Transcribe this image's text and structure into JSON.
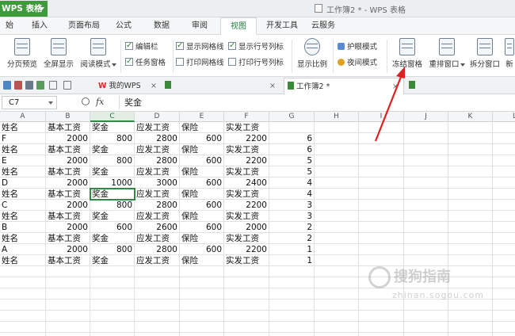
{
  "app": {
    "name": "WPS 表格",
    "window_title": "工作簿2 * - WPS 表格"
  },
  "menu": {
    "tabs": [
      {
        "label": "始"
      },
      {
        "label": "插入"
      },
      {
        "label": "页面布局"
      },
      {
        "label": "公式"
      },
      {
        "label": "数据"
      },
      {
        "label": "审阅"
      },
      {
        "label": "视图"
      },
      {
        "label": "开发工具"
      },
      {
        "label": "云服务"
      }
    ],
    "active": "视图"
  },
  "ribbon": {
    "page_preview": "分页预览",
    "full_screen": "全屏显示",
    "reading_mode": "阅读模式",
    "edit_bar": "编辑栏",
    "task_pane": "任务窗格",
    "show_gridlines": "显示网格线",
    "print_gridlines": "打印网格线",
    "show_row_col_headers": "显示行号列标",
    "print_row_col_headers": "打印行号列标",
    "zoom_ratio": "显示比例",
    "eye_protect": "护眼模式",
    "night_mode": "夜间模式",
    "freeze_panes": "冻结窗格",
    "arrange_window": "重排窗口",
    "split_window": "拆分窗口",
    "new_window": "新"
  },
  "tabs": {
    "my_wps": "我的WPS",
    "workbook": "工作簿2 *",
    "close": "×"
  },
  "formula_bar": {
    "name_box": "C7",
    "fx": "fx",
    "content": "奖金"
  },
  "columns": [
    "A",
    "B",
    "C",
    "D",
    "E",
    "F",
    "G",
    "H",
    "I",
    "J",
    "K",
    "L"
  ],
  "rows": [
    [
      "姓名",
      "基本工资",
      "奖金",
      "应发工资",
      "保险",
      "实发工资",
      "",
      ""
    ],
    [
      "F",
      "2000",
      "800",
      "2800",
      "600",
      "2200",
      "6"
    ],
    [
      "姓名",
      "基本工资",
      "奖金",
      "应发工资",
      "保险",
      "实发工资",
      "6"
    ],
    [
      "E",
      "2000",
      "800",
      "2800",
      "600",
      "2200",
      "5"
    ],
    [
      "姓名",
      "基本工资",
      "奖金",
      "应发工资",
      "保险",
      "实发工资",
      "5"
    ],
    [
      "D",
      "2000",
      "1000",
      "3000",
      "600",
      "2400",
      "4"
    ],
    [
      "姓名",
      "基本工资",
      "奖金",
      "应发工资",
      "保险",
      "实发工资",
      "4"
    ],
    [
      "C",
      "2000",
      "800",
      "2800",
      "600",
      "2200",
      "3"
    ],
    [
      "姓名",
      "基本工资",
      "奖金",
      "应发工资",
      "保险",
      "实发工资",
      "3"
    ],
    [
      "B",
      "2000",
      "600",
      "2600",
      "600",
      "2000",
      "2"
    ],
    [
      "姓名",
      "基本工资",
      "奖金",
      "应发工资",
      "保险",
      "实发工资",
      "2"
    ],
    [
      "A",
      "2000",
      "800",
      "2800",
      "600",
      "2200",
      "1"
    ],
    [
      "姓名",
      "基本工资",
      "奖金",
      "应发工资",
      "保险",
      "实发工资",
      "1"
    ]
  ],
  "selected_cell": "C7",
  "watermark": {
    "text": "搜狗指南",
    "url": "zhinan.sogou.com"
  },
  "colors": {
    "accent": "#3e9a3a",
    "annotation": "#e02020"
  }
}
